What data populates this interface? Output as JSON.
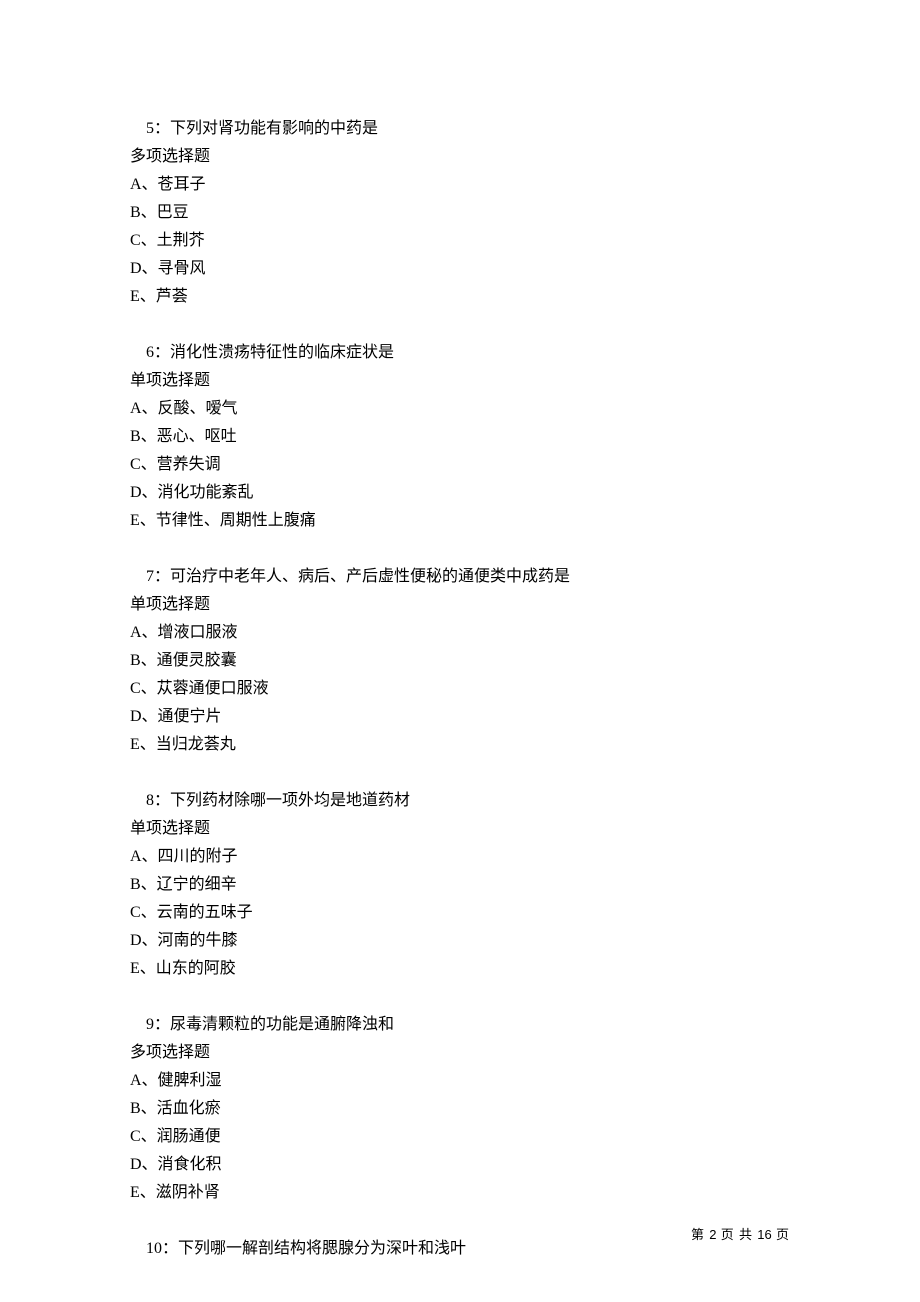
{
  "questions": [
    {
      "prompt": "5：下列对肾功能有影响的中药是",
      "type": "多项选择题",
      "options": [
        "A、苍耳子",
        "B、巴豆",
        "C、土荆芥",
        "D、寻骨风",
        "E、芦荟"
      ]
    },
    {
      "prompt": "6：消化性溃疡特征性的临床症状是",
      "type": "单项选择题",
      "options": [
        "A、反酸、嗳气",
        "B、恶心、呕吐",
        "C、营养失调",
        "D、消化功能紊乱",
        "E、节律性、周期性上腹痛"
      ]
    },
    {
      "prompt": "7：可治疗中老年人、病后、产后虚性便秘的通便类中成药是",
      "type": "单项选择题",
      "options": [
        "A、增液口服液",
        "B、通便灵胶囊",
        "C、苁蓉通便口服液",
        "D、通便宁片",
        "E、当归龙荟丸"
      ]
    },
    {
      "prompt": "8：下列药材除哪一项外均是地道药材",
      "type": "单项选择题",
      "options": [
        "A、四川的附子",
        "B、辽宁的细辛",
        "C、云南的五味子",
        "D、河南的牛膝",
        "E、山东的阿胶"
      ]
    },
    {
      "prompt": "9：尿毒清颗粒的功能是通腑降浊和",
      "type": "多项选择题",
      "options": [
        "A、健脾利湿",
        "B、活血化瘀",
        "C、润肠通便",
        "D、消食化积",
        "E、滋阴补肾"
      ]
    }
  ],
  "trailing_prompt": "10：下列哪一解剖结构将腮腺分为深叶和浅叶",
  "footer": {
    "prefix": "第 ",
    "page": "2",
    "mid": " 页 共 ",
    "total": "16",
    "suffix": " 页"
  }
}
